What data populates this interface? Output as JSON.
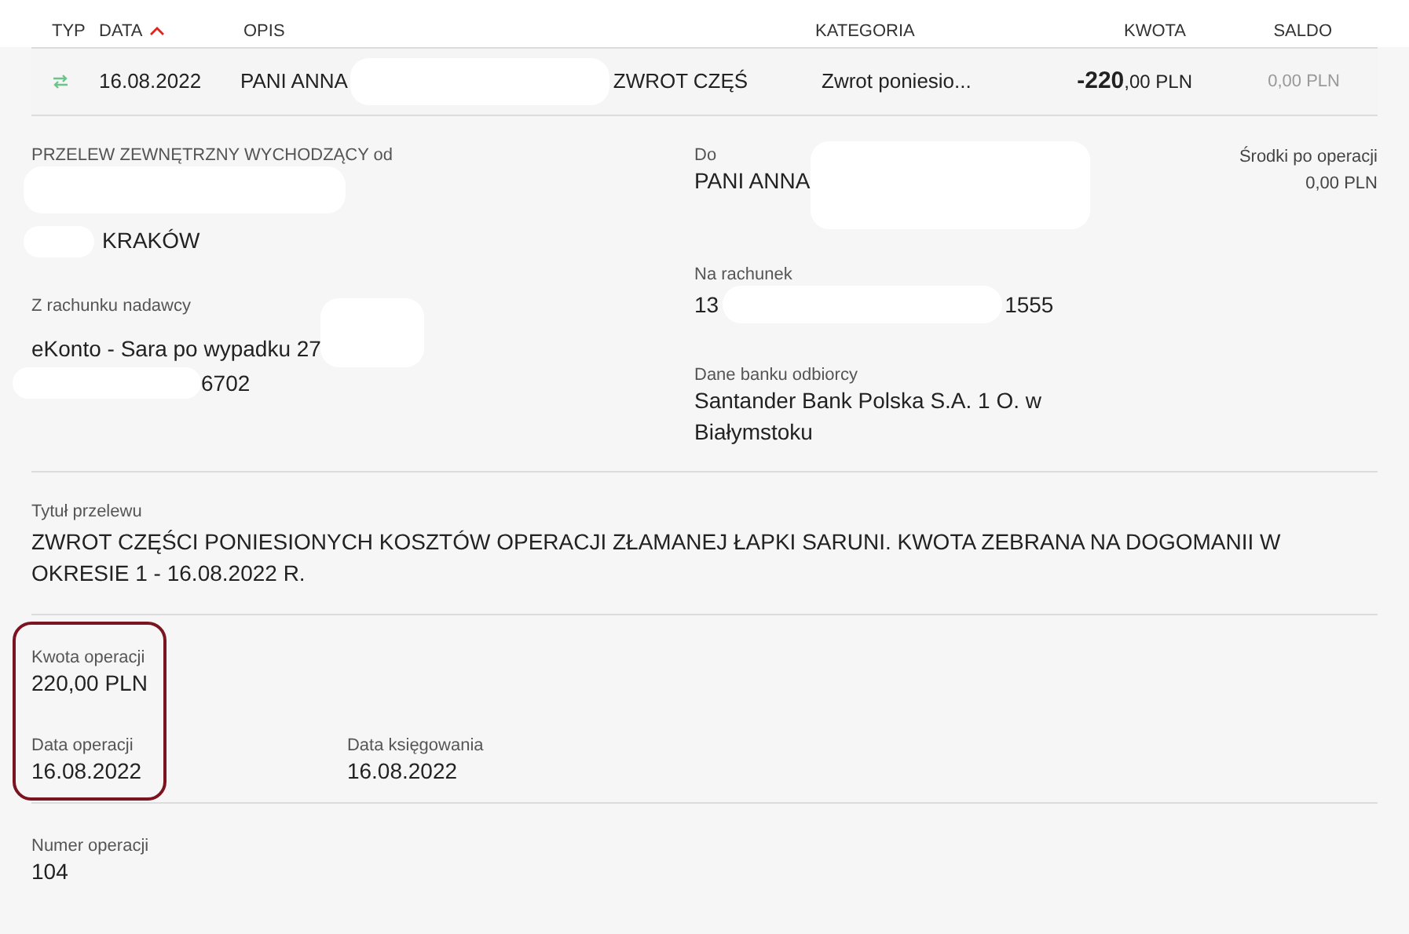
{
  "table": {
    "columns": [
      {
        "label": "TYP",
        "sorted": false
      },
      {
        "label": "DATA",
        "sorted": true
      },
      {
        "label": "OPIS",
        "sorted": false
      },
      {
        "label": "KATEGORIA",
        "sorted": false
      },
      {
        "label": "KWOTA",
        "sorted": false
      },
      {
        "label": "SALDO",
        "sorted": false
      }
    ],
    "row": {
      "date": "16.08.2022",
      "desc_start": "PANI ANNA",
      "desc_end": "ZWROT CZĘŚ",
      "category": "Zwrot poniesio...",
      "amount": "**-220**,00 PLN",
      "balance": "0,00 PLN"
    }
  },
  "details": {
    "sender_label": "PRZELEW ZEWNĘTRZNY WYCHODZĄCY od",
    "sender_city": "KRAKÓW",
    "recipient_label": "Do",
    "recipient": "PANI ANNA",
    "funds_label": "Środki po operacji",
    "funds_value": "0,00 PLN",
    "account_label": "Na rachunek",
    "account_start": "13",
    "account_end": "1555",
    "from_label": "Z rachunku nadawcy",
    "from_start": "eKonto - Sara po wypadku 27",
    "from_end": "6702",
    "bank_label": "Dane banku odbiorcy",
    "bank": "Santander Bank Polska S.A. 1 O. w Białymstoku",
    "title_label": "Tytuł przelewu",
    "title": "ZWROT CZĘŚCI PONIESIONYCH KOSZTÓW OPERACJI ZŁAMANEJ ŁAPKI SARUNI. KWOTA ZEBRANA NA DOGOMANII W OKRESIE 1 - 16.08.2022 R.",
    "amount_label": "Kwota operacji",
    "amount": "220,00 PLN",
    "op_date_label": "Data operacji",
    "op_date": "16.08.2022",
    "book_date_label": "Data księgowania",
    "book_date": "16.08.2022",
    "number_label": "Numer operacji",
    "number": "104"
  }
}
